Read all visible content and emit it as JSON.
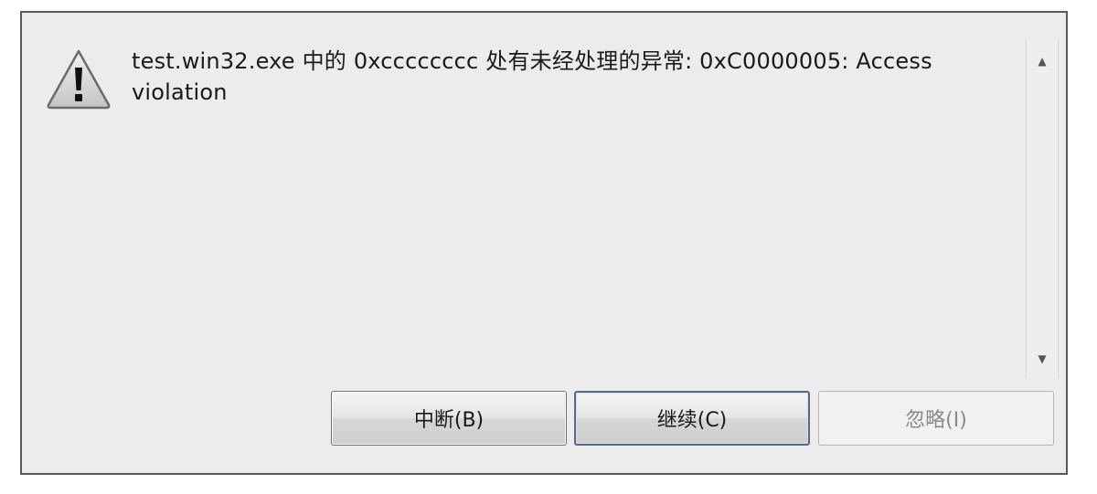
{
  "dialog": {
    "message": "test.win32.exe 中的 0xcccccccc 处有未经处理的异常: 0xC0000005: Access violation",
    "icon": "warning-triangle-icon",
    "buttons": {
      "break_label": "中断(B)",
      "continue_label": "继续(C)",
      "ignore_label": "忽略(I)"
    },
    "scrollbar": {
      "up_glyph": "▲",
      "down_glyph": "▼"
    }
  },
  "colors": {
    "dialog_background": "#ececec",
    "border": "#5a5a5a",
    "disabled_text": "#8a8a8a"
  }
}
